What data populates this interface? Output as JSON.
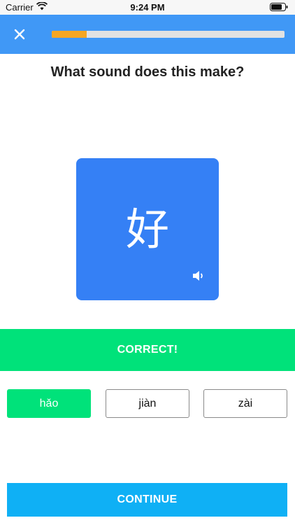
{
  "status_bar": {
    "carrier": "Carrier",
    "time": "9:24 PM"
  },
  "header": {
    "progress": 0.15,
    "progress_color": "#f5a623"
  },
  "question": "What sound does this make?",
  "card": {
    "character": "好",
    "color": "#3580f5"
  },
  "feedback": {
    "text": "CORRECT!",
    "color": "#00e27a"
  },
  "options": [
    {
      "label": "hǎo",
      "selected": true
    },
    {
      "label": "jiàn",
      "selected": false
    },
    {
      "label": "zài",
      "selected": false
    }
  ],
  "continue_label": "CONTINUE",
  "icons": [
    "wifi-icon",
    "battery-icon",
    "close-icon",
    "speaker-icon"
  ]
}
